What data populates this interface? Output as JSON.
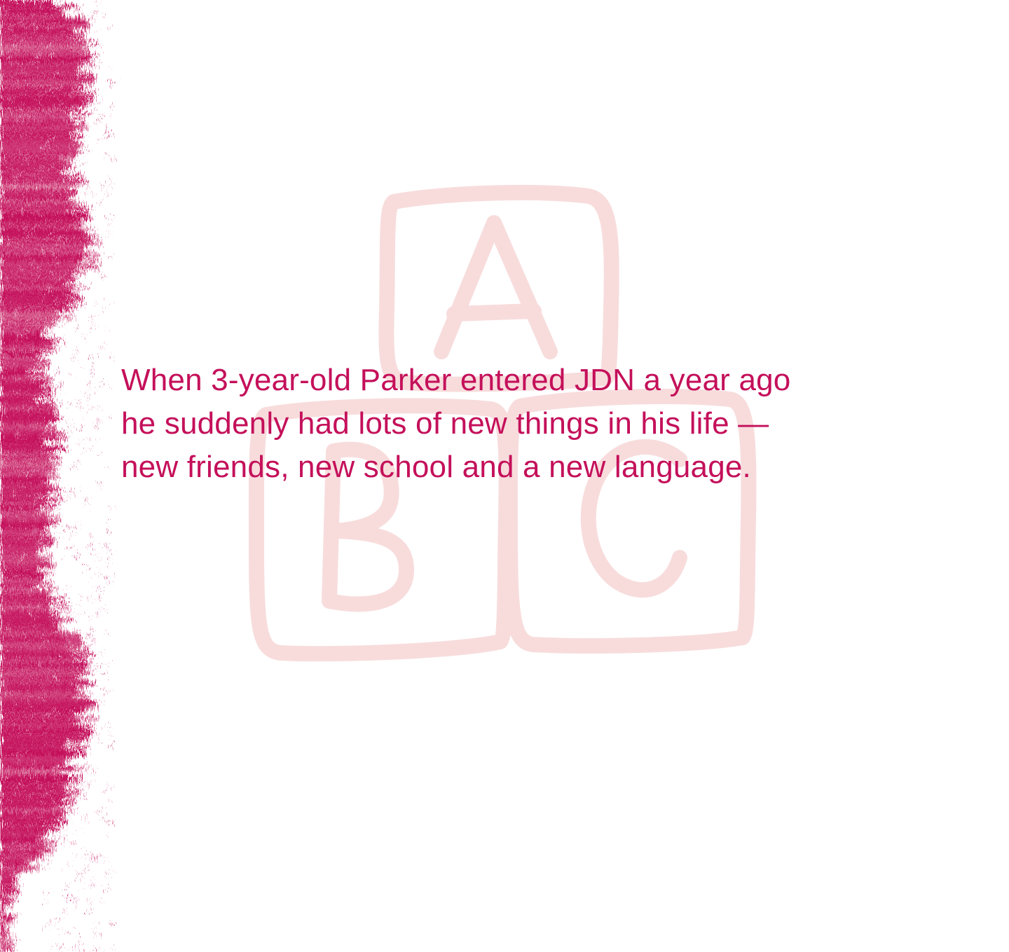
{
  "colors": {
    "accent": "#c4105a",
    "blocks_tint": "#f8dcdc",
    "background": "#ffffff"
  },
  "illustration": {
    "block_letters": [
      "A",
      "B",
      "C"
    ]
  },
  "intro_text": {
    "lines": [
      "When 3-year-old Parker entered JDN a year ago",
      "he suddenly had lots of new things in his life —",
      "new friends, new school and a new language."
    ]
  }
}
